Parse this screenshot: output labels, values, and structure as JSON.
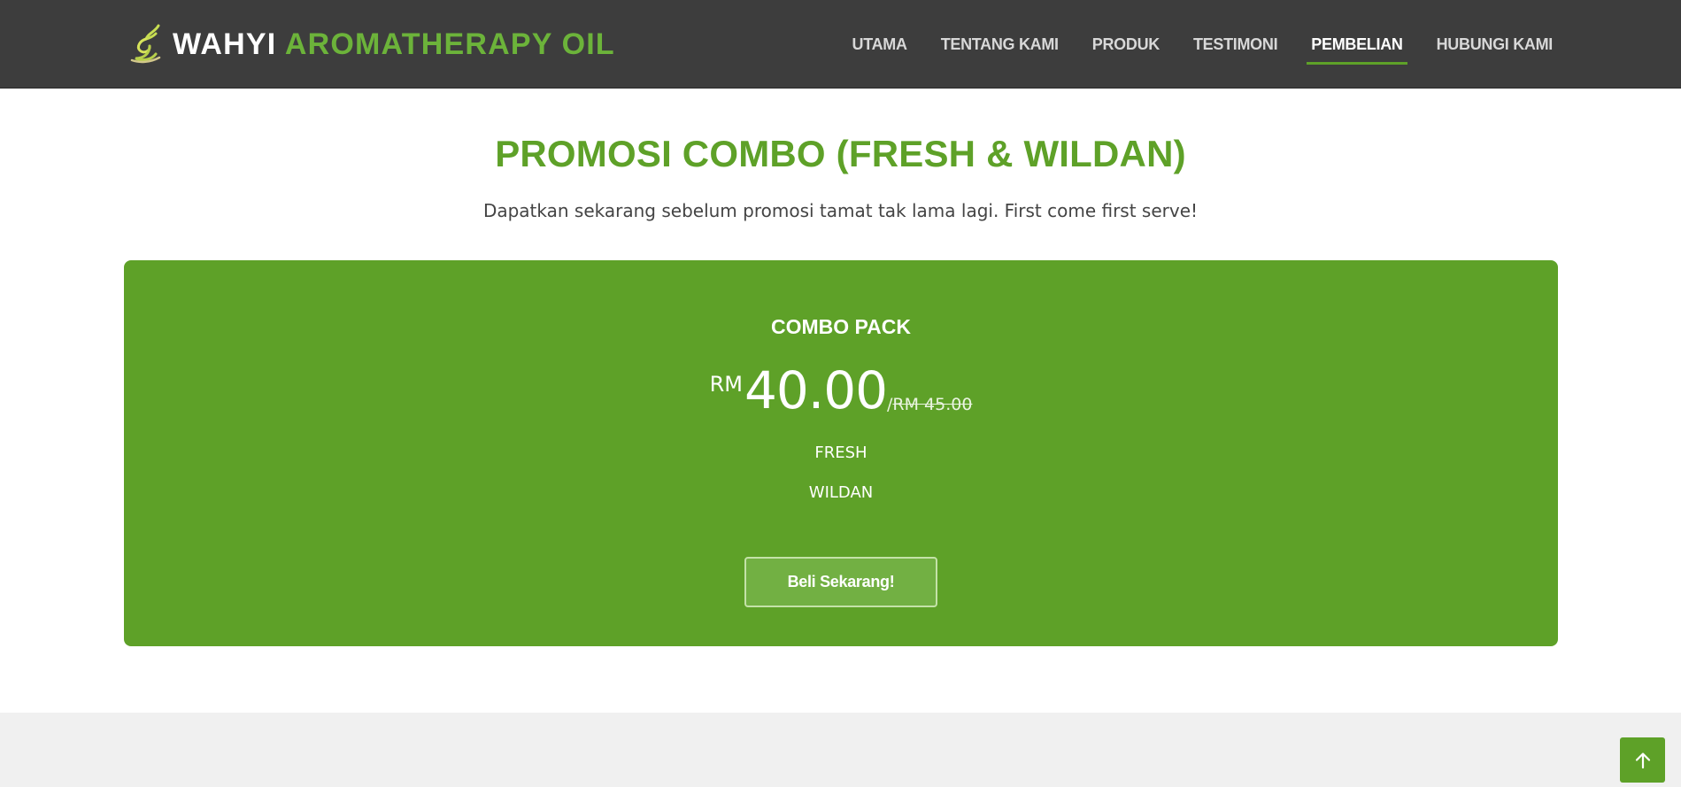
{
  "brand": {
    "name_part1": "WAHYI",
    "name_part2": "AROMATHERAPY OIL",
    "logo_icon": "leaf-calligraphy-icon",
    "colors": {
      "accent": "#5ea128",
      "header_bg": "#3d3d3d"
    }
  },
  "nav": {
    "items": [
      {
        "label": "UTAMA"
      },
      {
        "label": "TENTANG KAMI"
      },
      {
        "label": "PRODUK"
      },
      {
        "label": "TESTIMONI"
      },
      {
        "label": "PEMBELIAN"
      },
      {
        "label": "HUBUNGI KAMI"
      }
    ],
    "active": "PEMBELIAN"
  },
  "promo": {
    "title": "PROMOSI COMBO (FRESH & WILDAN)",
    "subtitle": "Dapatkan sekarang sebelum promosi tamat tak lama lagi. First come first serve!"
  },
  "plan": {
    "name": "COMBO PACK",
    "currency": "RM",
    "price": "40.00",
    "old_price_separator": "/",
    "old_price": "RM 45.00",
    "features": [
      "FRESH",
      "WILDAN"
    ],
    "cta_label": "Beli Sekarang!"
  },
  "back_to_top": {
    "icon": "arrow-up-icon"
  }
}
